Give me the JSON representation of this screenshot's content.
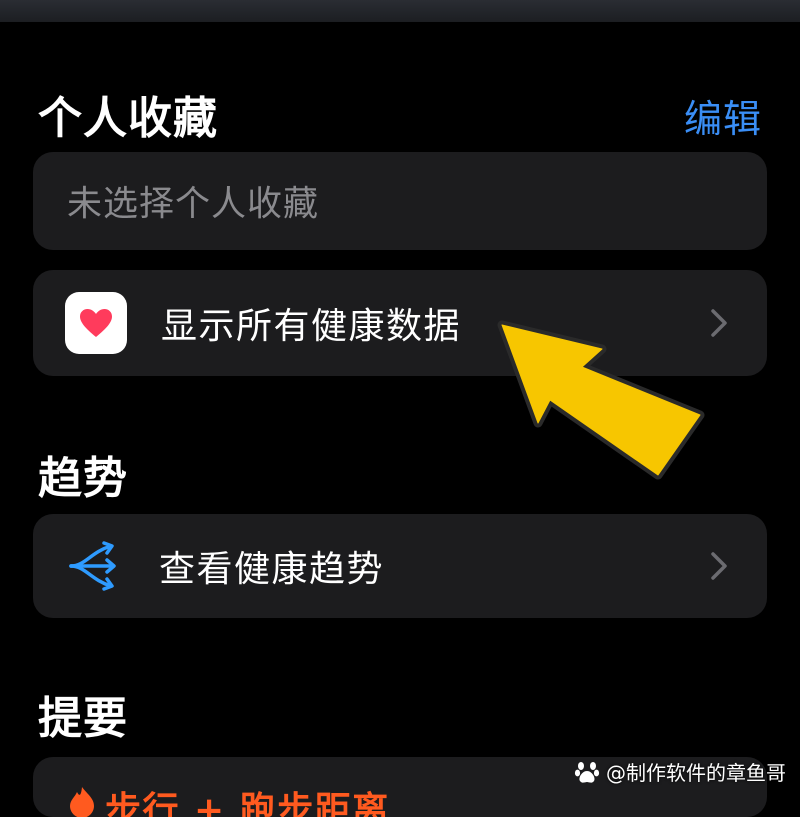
{
  "favorites": {
    "title": "个人收藏",
    "edit_label": "编辑",
    "empty_placeholder": "未选择个人收藏",
    "show_all_label": "显示所有健康数据"
  },
  "trends": {
    "title": "趋势",
    "view_label": "查看健康趋势"
  },
  "summary": {
    "title": "提要",
    "first_item_label": "步行 + 跑步距离"
  },
  "icons": {
    "health_app": "heart-icon",
    "trends": "trend-arrows-icon",
    "chevron": "chevron-right-icon",
    "flame": "flame-icon",
    "annotation": "yellow-arrow-annotation"
  },
  "colors": {
    "background": "#000000",
    "card": "#1c1c1e",
    "accent_blue": "#3a8ef6",
    "heart_red": "#ff3b5c",
    "trend_blue": "#2e9bff",
    "summary_orange": "#ff5a1f",
    "annotation_yellow": "#f7c600"
  },
  "watermark": {
    "text": "@制作软件的章鱼哥"
  }
}
